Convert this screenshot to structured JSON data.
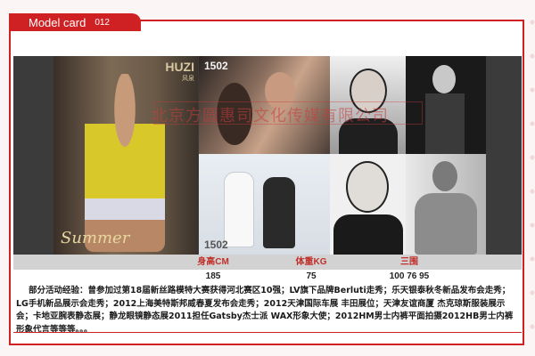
{
  "card": {
    "title": "Model card",
    "number": "012"
  },
  "photos": {
    "watermark_overlay": "北京方圆惠司文化传媒有限公司",
    "brand_text": "HUZI",
    "brand_sub": "风泉",
    "caption_script": "Summer",
    "stamp_top": "1502",
    "stamp_bottom": "1502"
  },
  "stats": {
    "headers": [
      "身高CM",
      "体重KG",
      "三围"
    ],
    "values": [
      "185",
      "75",
      "100 76 95"
    ]
  },
  "description": "部分活动经验：曾参加过第18届新丝路模特大赛获得河北赛区10强；LV旗下品牌Berluti走秀；乐天银泰秋冬新品发布会走秀；LG手机新品展示会走秀；2012上海美特斯邦威春夏发布会走秀；2012天津国际车展 丰田展位；天津友谊商厦 杰克琼斯服装展示会；卡地亚腕表静态展；静龙眼镜静态展2011担任Gatsby杰士派 WAX形象大使；2012HM男士内裤平面拍摄2012HB男士内裤形象代言等等等。。。",
  "colors": {
    "accent": "#cf2124",
    "header_band": "#d2d2d2",
    "header_text": "#c0302b"
  }
}
